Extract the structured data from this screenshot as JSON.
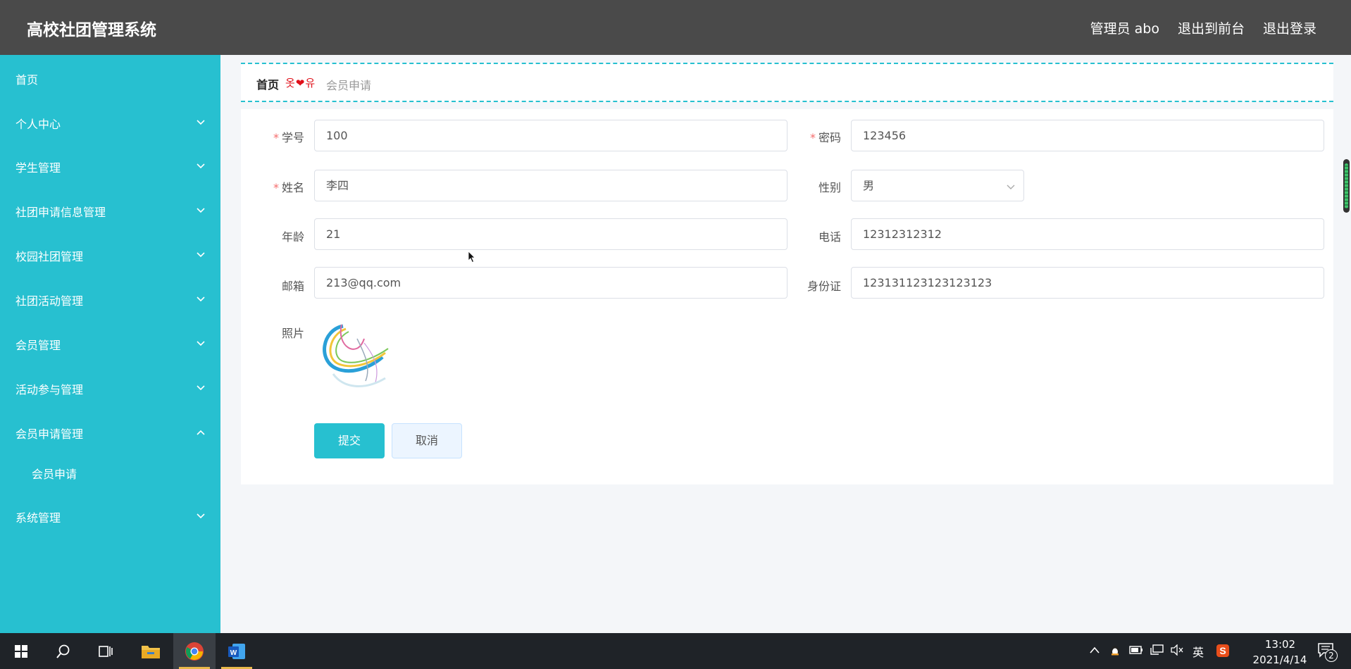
{
  "header": {
    "app_title": "高校社团管理系统",
    "admin_label": "管理员 abo",
    "frontend_link": "退出到前台",
    "logout_link": "退出登录"
  },
  "sidebar": {
    "items": [
      {
        "label": "首页",
        "icon": "none"
      },
      {
        "label": "个人中心",
        "icon": "chevron-down-icon"
      },
      {
        "label": "学生管理",
        "icon": "chevron-down-icon"
      },
      {
        "label": "社团申请信息管理",
        "icon": "chevron-down-icon"
      },
      {
        "label": "校园社团管理",
        "icon": "chevron-down-icon"
      },
      {
        "label": "社团活动管理",
        "icon": "chevron-down-icon"
      },
      {
        "label": "会员管理",
        "icon": "chevron-down-icon"
      },
      {
        "label": "活动参与管理",
        "icon": "chevron-down-icon"
      },
      {
        "label": "会员申请管理",
        "icon": "chevron-up-icon"
      },
      {
        "label": "会员申请",
        "icon": "none"
      },
      {
        "label": "系统管理",
        "icon": "chevron-down-icon"
      }
    ]
  },
  "breadcrumb": {
    "home": "首页",
    "separator": "옷❤유",
    "current": "会员申请"
  },
  "form": {
    "student_id": {
      "label": "学号",
      "required_mark": "*",
      "value": "100"
    },
    "password": {
      "label": "密码",
      "required_mark": "*",
      "value": "123456"
    },
    "name": {
      "label": "姓名",
      "required_mark": "*",
      "value": "李四"
    },
    "gender": {
      "label": "性别",
      "value": "男"
    },
    "age": {
      "label": "年龄",
      "value": "21"
    },
    "phone": {
      "label": "电话",
      "value": "12312312312"
    },
    "email": {
      "label": "邮箱",
      "value": "213@qq.com"
    },
    "id_card": {
      "label": "身份证",
      "value": "123131123123123123"
    },
    "photo": {
      "label": "照片"
    },
    "submit_label": "提交",
    "cancel_label": "取消"
  },
  "taskbar": {
    "ime_label": "英",
    "time": "13:02",
    "date": "2021/4/14",
    "notification_count": "2"
  },
  "colors": {
    "accent": "#27c0d0",
    "header_bg": "#4a4a4a",
    "required": "#f56c6c"
  }
}
